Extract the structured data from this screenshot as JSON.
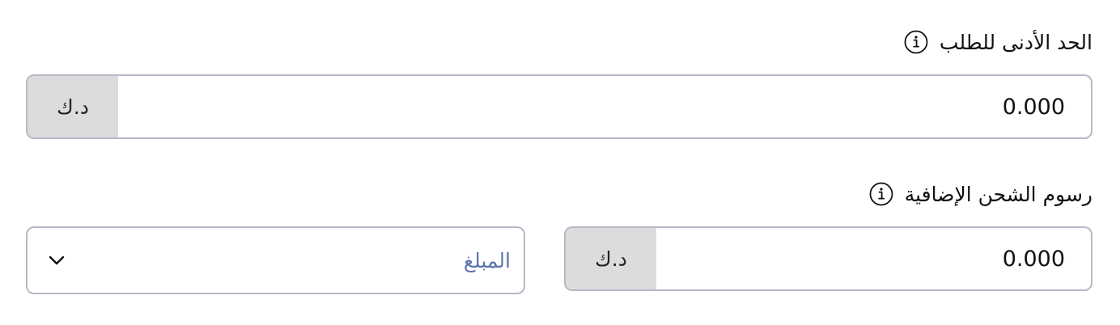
{
  "min_order": {
    "label": "الحد الأدنى للطلب",
    "info_icon": "info-icon",
    "value": "0.000",
    "currency": "د.ك"
  },
  "extra_shipping": {
    "label": "رسوم الشحن الإضافية",
    "info_icon": "info-icon",
    "value": "0.000",
    "currency": "د.ك",
    "type_select": {
      "selected": "المبلغ",
      "icon": "chevron-down-icon"
    }
  },
  "colors": {
    "border": "#b7b7c7",
    "addon_bg": "#dcdcdc",
    "select_text": "#5a74ad"
  }
}
